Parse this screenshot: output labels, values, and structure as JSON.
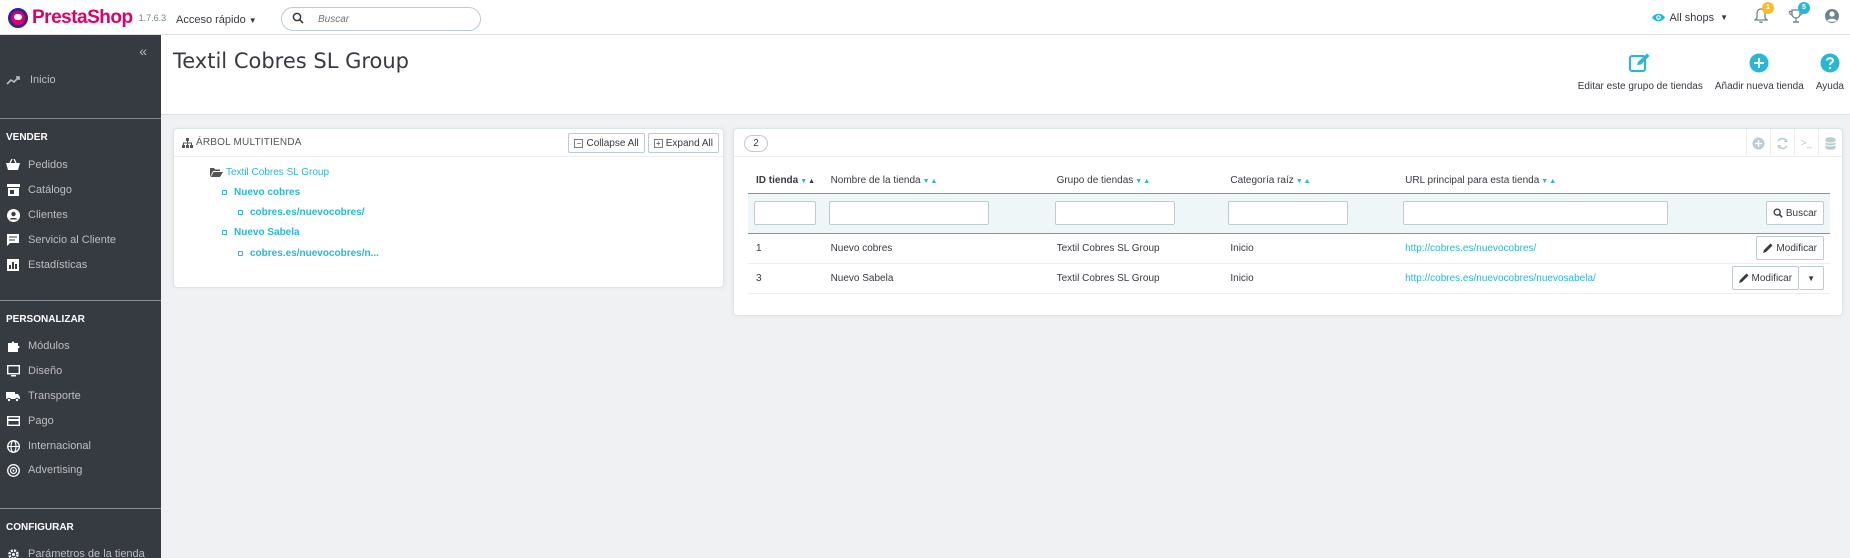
{
  "header": {
    "brand": "PrestaShop",
    "version": "1.7.6.3",
    "quick_access": "Acceso rápido",
    "search_placeholder": "Buscar",
    "shop_selector": "All shops",
    "notifications_count": "1",
    "orders_count": "5",
    "colors": {
      "brand_pink": "#df0067",
      "accent": "#25b9d7",
      "badge_orange": "#fbbb22"
    }
  },
  "sidebar": {
    "home": "Inicio",
    "sections": [
      {
        "title": "VENDER",
        "items": [
          {
            "label": "Pedidos",
            "icon": "cart-icon"
          },
          {
            "label": "Catálogo",
            "icon": "store-icon"
          },
          {
            "label": "Clientes",
            "icon": "account-icon"
          },
          {
            "label": "Servicio al Cliente",
            "icon": "chat-icon"
          },
          {
            "label": "Estadísticas",
            "icon": "bar-chart-icon"
          }
        ]
      },
      {
        "title": "PERSONALIZAR",
        "items": [
          {
            "label": "Módulos",
            "icon": "puzzle-icon"
          },
          {
            "label": "Diseño",
            "icon": "desktop-icon"
          },
          {
            "label": "Transporte",
            "icon": "truck-icon"
          },
          {
            "label": "Pago",
            "icon": "credit-card-icon"
          },
          {
            "label": "Internacional",
            "icon": "globe-icon"
          },
          {
            "label": "Advertising",
            "icon": "advertising-icon"
          }
        ]
      },
      {
        "title": "CONFIGURAR",
        "items": [
          {
            "label": "Parámetros de la tienda",
            "icon": "settings-icon"
          }
        ]
      }
    ]
  },
  "page": {
    "title": "Textil Cobres SL Group",
    "toolbar": [
      {
        "label": "Editar este grupo de tiendas",
        "icon": "edit-icon"
      },
      {
        "label": "Añadir nueva tienda",
        "icon": "add-circle-icon"
      },
      {
        "label": "Ayuda",
        "icon": "help-icon"
      }
    ]
  },
  "tree": {
    "title": "ÁRBOL MULTITIENDA",
    "collapse_label": "Collapse All",
    "expand_label": "Expand All",
    "root": "Textil Cobres SL Group",
    "nodes": [
      {
        "label": "Nuevo cobres",
        "children": [
          "cobres.es/nuevocobres/"
        ]
      },
      {
        "label": "Nuevo Sabela",
        "children": [
          "cobres.es/nuevocobres/n..."
        ]
      }
    ]
  },
  "list": {
    "count": "2",
    "columns": [
      "ID tienda",
      "Nombre de la tienda",
      "Grupo de tiendas",
      "Categoría raíz",
      "URL principal para esta tienda"
    ],
    "search_button": "Buscar",
    "rows": [
      {
        "id": "1",
        "name": "Nuevo cobres",
        "group": "Textil Cobres SL Group",
        "category": "Inicio",
        "url": "http://cobres.es/nuevocobres/",
        "action": "Modificar"
      },
      {
        "id": "3",
        "name": "Nuevo Sabela",
        "group": "Textil Cobres SL Group",
        "category": "Inicio",
        "url": "http://cobres.es/nuevocobres/nuevosabela/",
        "action": "Modificar"
      }
    ]
  }
}
